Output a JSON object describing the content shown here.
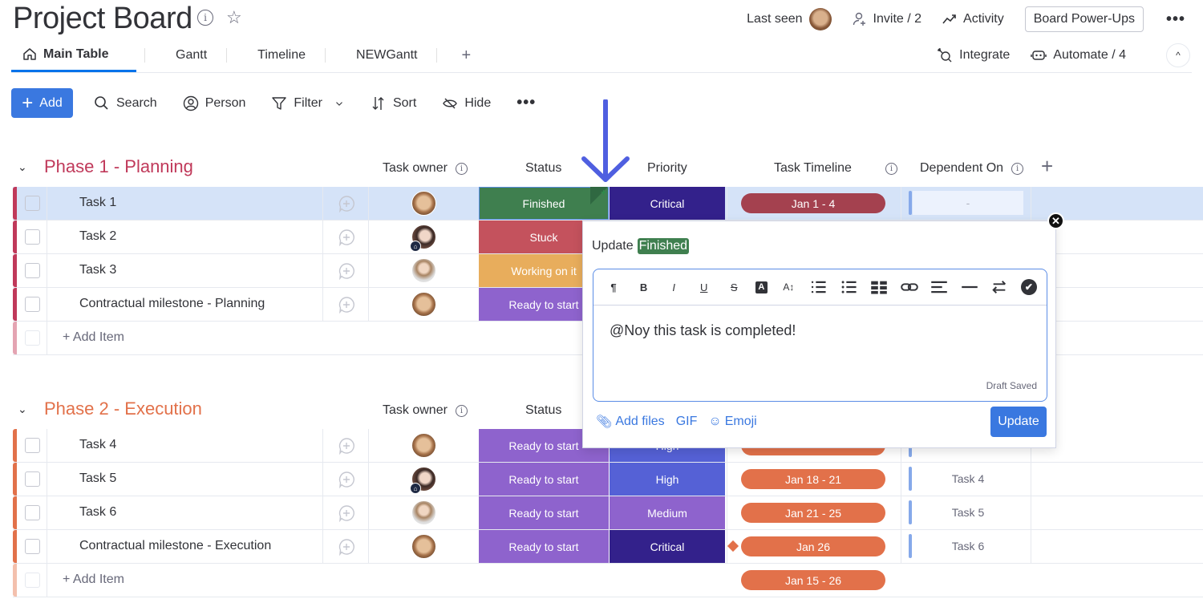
{
  "header": {
    "title": "Project Board",
    "last_seen_label": "Last seen",
    "invite_label": "Invite / 2",
    "activity_label": "Activity",
    "power_ups_label": "Board Power-Ups",
    "more_label": "•••"
  },
  "tabs": [
    {
      "label": "Main Table",
      "active": true
    },
    {
      "label": "Gantt"
    },
    {
      "label": "Timeline"
    },
    {
      "label": "NEWGantt"
    }
  ],
  "tabs_add": "+",
  "tabs_right": {
    "integrate_label": "Integrate",
    "automate_label": "Automate / 4",
    "collapse_label": "^"
  },
  "toolbar": {
    "add_label": "Add",
    "search_label": "Search",
    "person_label": "Person",
    "filter_label": "Filter",
    "sort_label": "Sort",
    "hide_label": "Hide",
    "more_label": "•••"
  },
  "columns": {
    "task_owner": "Task owner",
    "status": "Status",
    "priority": "Priority",
    "task_timeline": "Task Timeline",
    "dependent_on": "Dependent On",
    "add_column": "+"
  },
  "colors": {
    "phase1": "#c0395a",
    "phase2": "#e2714a",
    "Finished": "#3f7f4f",
    "Stuck": "#c4525d",
    "Working on it": "#e8ad5c",
    "Ready to start": "#8e63cd",
    "Critical": "#33218b",
    "High": "#5561d6",
    "Medium": "#8e63cd",
    "timeline_phase1": "#a4414f",
    "timeline_phase2": "#e2714a",
    "accent": "#3a78e0"
  },
  "groups": [
    {
      "title": "Phase 1 - Planning",
      "add_item_label": "+ Add Item",
      "rows": [
        {
          "name": "Task 1",
          "owner": "a",
          "status": "Finished",
          "priority": "Critical",
          "timeline": "Jan 1 - 4",
          "dependent_on": "-",
          "selected": true
        },
        {
          "name": "Task 2",
          "owner": "b",
          "status": "Stuck"
        },
        {
          "name": "Task 3",
          "owner": "c",
          "status": "Working on it"
        },
        {
          "name": "Contractual milestone - Planning",
          "owner": "a",
          "status": "Ready to start"
        }
      ]
    },
    {
      "title": "Phase 2 - Execution",
      "add_item_label": "+ Add Item",
      "summary_timeline": "Jan 15 - 26",
      "rows": [
        {
          "name": "Task 4",
          "owner": "a",
          "status": "Ready to start",
          "priority": "High",
          "timeline": ""
        },
        {
          "name": "Task 5",
          "owner": "b",
          "status": "Ready to start",
          "priority": "High",
          "timeline": "Jan 18 - 21",
          "dependent_on": "Task 4"
        },
        {
          "name": "Task 6",
          "owner": "c",
          "status": "Ready to start",
          "priority": "Medium",
          "timeline": "Jan 21 - 25",
          "dependent_on": "Task 5"
        },
        {
          "name": "Contractual milestone - Execution",
          "owner": "a",
          "status": "Ready to start",
          "priority": "Critical",
          "timeline": "Jan 26",
          "dependent_on": "Task 6",
          "milestone": true
        }
      ]
    }
  ],
  "popup": {
    "title_prefix": "Update",
    "title_tag": "Finished",
    "editor_text": "@Noy this task is completed!",
    "draft_status": "Draft Saved",
    "add_files_label": "Add files",
    "gif_label": "GIF",
    "emoji_label": "Emoji",
    "update_button": "Update",
    "close_label": "✕",
    "toolbar_icons": [
      "paragraph-icon",
      "bold-icon",
      "italic-icon",
      "underline-icon",
      "strikethrough-icon",
      "text-color-icon",
      "font-size-icon",
      "numbered-list-icon",
      "bullet-list-icon",
      "table-icon",
      "link-icon",
      "align-icon",
      "divider-icon",
      "direction-icon",
      "check-icon"
    ]
  }
}
